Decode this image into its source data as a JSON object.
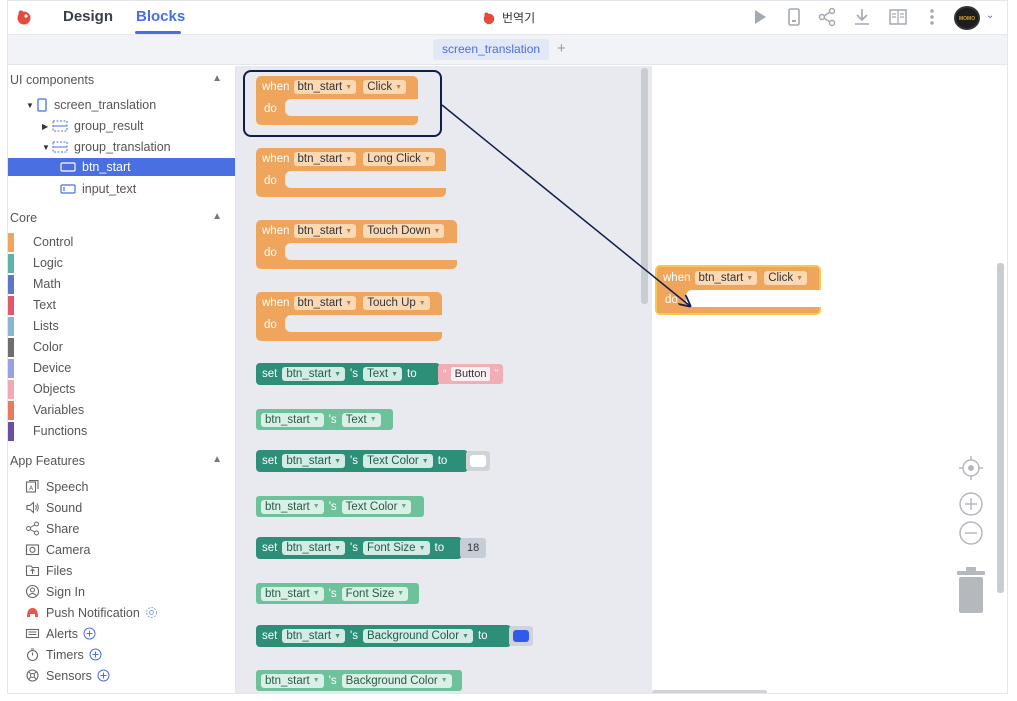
{
  "topbar": {
    "tabs": {
      "design": "Design",
      "blocks": "Blocks"
    },
    "project_name": "번역기",
    "icons": [
      "play-icon",
      "phone-preview-icon",
      "share-icon",
      "download-icon",
      "book-icon",
      "more-icon"
    ],
    "avatar_text": "MOMO"
  },
  "screen_bar": {
    "active_screen": "screen_translation",
    "add_label": "+"
  },
  "sidebar": {
    "ui_components_title": "UI components",
    "tree": [
      {
        "label": "screen_translation",
        "level": 0
      },
      {
        "label": "group_result",
        "level": 1
      },
      {
        "label": "group_translation",
        "level": 1
      },
      {
        "label": "btn_start",
        "level": 2,
        "selected": true
      },
      {
        "label": "input_text",
        "level": 2
      }
    ],
    "core_title": "Core",
    "core": [
      {
        "label": "Control",
        "color": "#f0a55c"
      },
      {
        "label": "Logic",
        "color": "#5bb5a2"
      },
      {
        "label": "Math",
        "color": "#5a78c7"
      },
      {
        "label": "Text",
        "color": "#e0586b"
      },
      {
        "label": "Lists",
        "color": "#8ab6d6"
      },
      {
        "label": "Color",
        "color": "#6e6e6e"
      },
      {
        "label": "Device",
        "color": "#9aa0e8"
      },
      {
        "label": "Objects",
        "color": "#f2a8b5"
      },
      {
        "label": "Variables",
        "color": "#ea7a5c"
      },
      {
        "label": "Functions",
        "color": "#6a4fa3"
      }
    ],
    "features_title": "App Features",
    "features": [
      {
        "label": "Speech",
        "icon": "speech-icon"
      },
      {
        "label": "Sound",
        "icon": "sound-icon"
      },
      {
        "label": "Share",
        "icon": "share-icon"
      },
      {
        "label": "Camera",
        "icon": "camera-icon"
      },
      {
        "label": "Files",
        "icon": "files-icon"
      },
      {
        "label": "Sign In",
        "icon": "sign-in-icon"
      },
      {
        "label": "Push Notification",
        "icon": "push-notification-icon"
      },
      {
        "label": "Alerts",
        "icon": "alerts-icon"
      },
      {
        "label": "Timers",
        "icon": "timers-icon"
      },
      {
        "label": "Sensors",
        "icon": "sensors-icon"
      }
    ]
  },
  "flyout": {
    "events": [
      {
        "when": "when",
        "component": "btn_start",
        "event": "Click",
        "do": "do"
      },
      {
        "when": "when",
        "component": "btn_start",
        "event": "Long Click",
        "do": "do"
      },
      {
        "when": "when",
        "component": "btn_start",
        "event": "Touch Down",
        "do": "do"
      },
      {
        "when": "when",
        "component": "btn_start",
        "event": "Touch Up",
        "do": "do"
      }
    ],
    "setters_getters": {
      "set": "set",
      "to": "to",
      "poss": "'s",
      "component": "btn_start",
      "text_prop": "Text",
      "text_value": "Button",
      "text_color_prop": "Text Color",
      "text_color_value": "#ffffff",
      "font_size_prop": "Font Size",
      "font_size_value": "18",
      "bg_color_prop": "Background Color",
      "bg_color_value": "#2f5be8",
      "open_quote": "“",
      "close_quote": "”"
    }
  },
  "workspace": {
    "placed_block": {
      "when": "when",
      "component": "btn_start",
      "event": "Click",
      "do": "do"
    }
  },
  "colors": {
    "accent": "#4a6fe3",
    "event_block": "#f0a55c",
    "set_block": "#2e8f78",
    "get_block": "#6dc29c",
    "highlight": "#0f1e4a"
  }
}
